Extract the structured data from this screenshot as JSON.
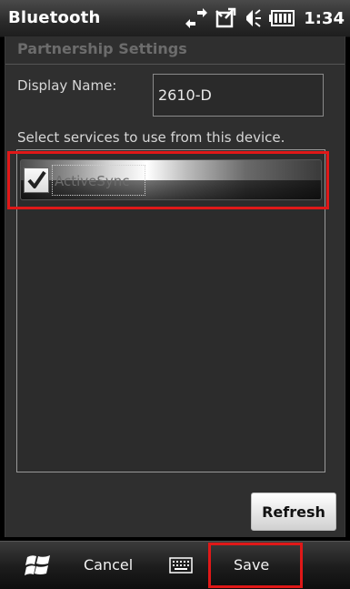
{
  "status_bar": {
    "app_title": "Bluetooth",
    "time": "1:34",
    "icons": [
      "sync-arrows-icon",
      "signal-icon",
      "volume-icon",
      "battery-icon"
    ]
  },
  "partnership": {
    "section_title": "Partnership Settings",
    "display_name_label": "Display Name:",
    "display_name_value": "2610-D",
    "services_prompt": "Select services to use from this device.",
    "services": [
      {
        "label": "ActiveSync",
        "checked": true
      }
    ],
    "refresh_label": "Refresh"
  },
  "softkeys": {
    "start_icon": "windows-start-icon",
    "left_label": "Cancel",
    "keyboard_icon": "keyboard-icon",
    "right_label": "Save"
  },
  "colors": {
    "highlight": "#e01818",
    "background": "#2f2f2f",
    "text": "#d7d7d7"
  }
}
